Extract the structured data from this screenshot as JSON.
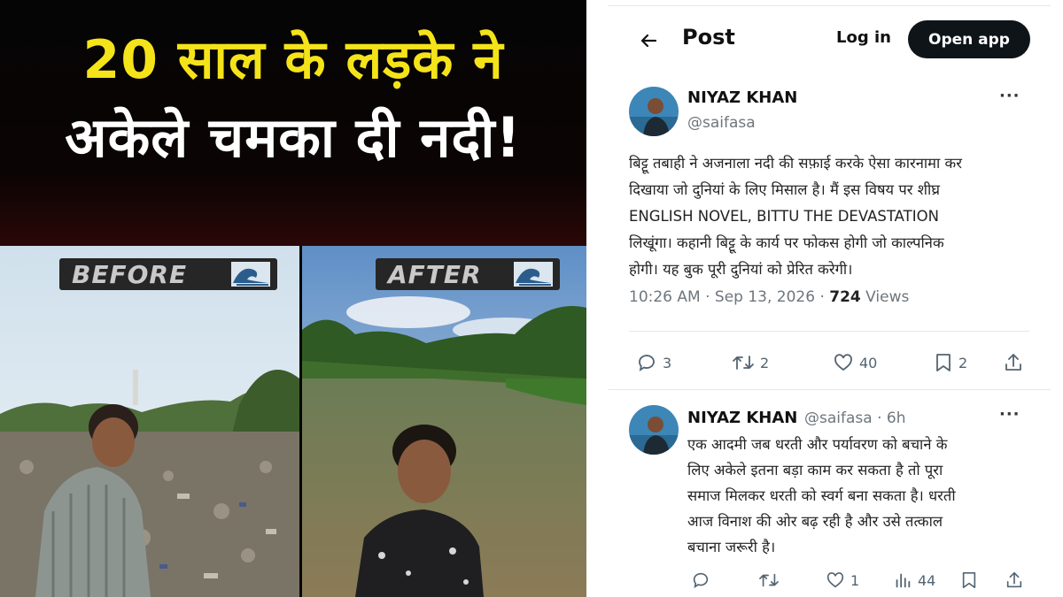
{
  "thumbnail": {
    "headline_line1": "20 साल के लड़के ने",
    "headline_line2": "अकेले चमका दी नदी!",
    "before_label": "BEFORE",
    "after_label": "AFTER"
  },
  "navbar": {
    "title": "Post",
    "login_label": "Log in",
    "open_app_label": "Open app"
  },
  "tweet": {
    "author_name": "NIYAZ KHAN",
    "author_handle": "@saifasa",
    "more_label": "···",
    "text_lines": [
      "बिट्टू तबाही ने अजनाला नदी की सफ़ाई करके ऐसा कारनामा कर",
      "दिखाया जो दुनियां के लिए मिसाल है। मैं इस विषय पर शीघ्र",
      "ENGLISH NOVEL, BITTU THE DEVASTATION",
      "लिखूंगा। कहानी बिट्टू के कार्य पर फोकस होगी जो काल्पनिक",
      "होगी। यह बुक पूरी दुनियां को प्रेरित करेगी।"
    ],
    "timestamp": "10:26 AM · Sep 13, 2026 · ",
    "views_count": "724",
    "views_label": " Views",
    "replies": "3",
    "reposts": "2",
    "likes": "40",
    "bookmarks": "2"
  },
  "reply": {
    "author_name": "NIYAZ KHAN",
    "author_handle": "@saifasa · 6h",
    "more_label": "···",
    "text_lines": [
      "एक आदमी जब धरती और पर्यावरण को बचाने के",
      "लिए अकेले इतना बड़ा काम कर सकता है तो पूरा",
      "समाज मिलकर धरती को स्वर्ग बना सकता है। धरती",
      "आज विनाश की ओर बढ़ रही है और उसे तत्काल",
      "बचाना जरूरी है।"
    ],
    "replies": "",
    "reposts": "",
    "likes": "1",
    "views": "44"
  },
  "colors": {
    "headline_yellow": "#f5e31a",
    "button_dark": "#0f1419",
    "muted_text": "#6e767d"
  },
  "icons": [
    "back-arrow-icon",
    "more-icon",
    "reply-icon",
    "repost-icon",
    "like-icon",
    "bookmark-icon",
    "share-icon",
    "views-icon",
    "wave-icon"
  ]
}
